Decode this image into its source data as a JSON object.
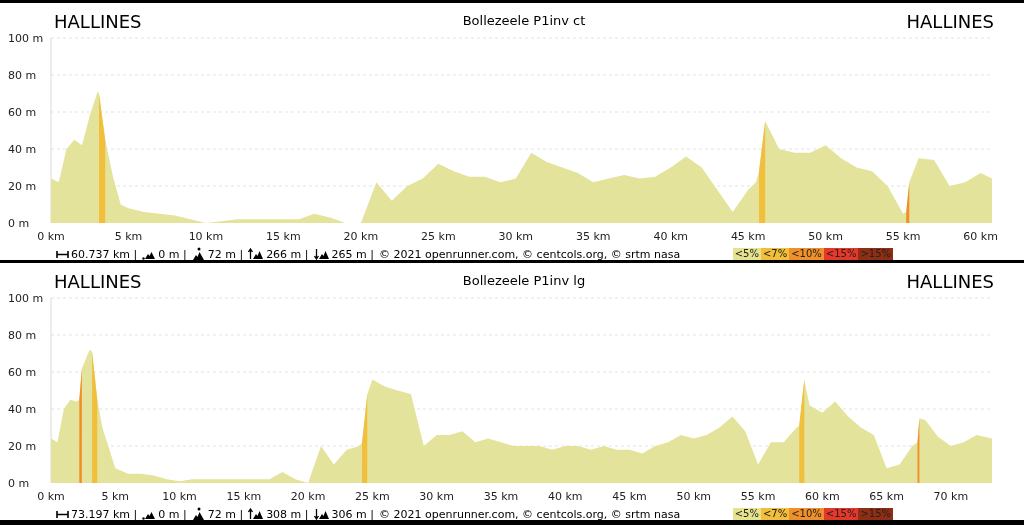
{
  "panels": [
    {
      "start": "HALLINES",
      "title": "Bollezeele P1inv ct",
      "finish": "HALLINES",
      "chart_data": {
        "type": "area",
        "xlim": [
          0,
          60.737
        ],
        "ylim": [
          0,
          100
        ],
        "xticks": [
          {
            "value": 0,
            "label": "0 km"
          },
          {
            "value": 5,
            "label": "5 km"
          },
          {
            "value": 10,
            "label": "10 km"
          },
          {
            "value": 15,
            "label": "15 km"
          },
          {
            "value": 20,
            "label": "20 km"
          },
          {
            "value": 25,
            "label": "25 km"
          },
          {
            "value": 30,
            "label": "30 km"
          },
          {
            "value": 35,
            "label": "35 km"
          },
          {
            "value": 40,
            "label": "40 km"
          },
          {
            "value": 45,
            "label": "45 km"
          },
          {
            "value": 50,
            "label": "50 km"
          },
          {
            "value": 55,
            "label": "55 km"
          },
          {
            "value": 60,
            "label": "60 km"
          }
        ],
        "yticks": [
          {
            "value": 0,
            "label": "0 m"
          },
          {
            "value": 20,
            "label": "20 m"
          },
          {
            "value": 40,
            "label": "40 m"
          },
          {
            "value": 60,
            "label": "60 m"
          },
          {
            "value": 80,
            "label": "80 m"
          },
          {
            "value": 100,
            "label": "100 m"
          }
        ],
        "x": [
          0,
          0.5,
          1,
          1.5,
          2,
          2.5,
          3,
          3.1,
          3.5,
          4,
          4.5,
          5,
          6,
          7,
          8,
          9,
          10,
          11,
          12,
          13,
          14,
          15,
          16,
          17,
          18,
          19,
          20,
          21,
          22,
          23,
          24,
          25,
          26,
          27,
          28,
          29,
          30,
          31,
          32,
          33,
          34,
          35,
          36,
          37,
          38,
          39,
          40,
          41,
          42,
          43,
          44,
          45,
          45.5,
          45.7,
          46.1,
          47,
          48,
          49,
          50,
          51,
          52,
          53,
          54,
          55,
          55.2,
          55.4,
          56,
          57,
          58,
          59,
          60,
          60.737
        ],
        "series": [
          {
            "color": "#e4e39b",
            "values": [
              24,
              22,
              40,
              45,
              42,
              58,
              71,
              70,
              45,
              25,
              10,
              8,
              6,
              5,
              4,
              2,
              0,
              1,
              2,
              2,
              2,
              2,
              2,
              5,
              3,
              0,
              0,
              22,
              12,
              20,
              24,
              32,
              28,
              25,
              25,
              22,
              24,
              38,
              33,
              30,
              27,
              22,
              24,
              26,
              24,
              25,
              30,
              36,
              30,
              18,
              6,
              18,
              22,
              28,
              55,
              40,
              38,
              38,
              42,
              35,
              30,
              28,
              20,
              5,
              6,
              22,
              35,
              34,
              20,
              22,
              27,
              24
            ]
          },
          {
            "color": "#f2bf3c",
            "values": [
              null,
              null,
              null,
              null,
              null,
              null,
              null,
              70,
              45,
              null,
              null,
              null,
              null,
              null,
              null,
              null,
              null,
              null,
              null,
              null,
              null,
              null,
              null,
              null,
              null,
              null,
              null,
              null,
              null,
              null,
              null,
              null,
              null,
              null,
              null,
              null,
              null,
              null,
              null,
              null,
              null,
              null,
              null,
              null,
              null,
              null,
              null,
              null,
              null,
              null,
              null,
              null,
              null,
              28,
              55,
              null,
              null,
              null,
              null,
              null,
              null,
              null,
              null,
              null,
              null,
              null,
              null,
              null,
              null,
              null,
              null,
              null
            ]
          },
          {
            "color": "#f0902a",
            "values": [
              null,
              null,
              null,
              null,
              null,
              null,
              null,
              null,
              null,
              null,
              null,
              null,
              null,
              null,
              null,
              null,
              null,
              null,
              null,
              null,
              null,
              null,
              null,
              null,
              null,
              null,
              null,
              null,
              null,
              null,
              null,
              null,
              null,
              null,
              null,
              null,
              null,
              null,
              null,
              null,
              null,
              null,
              null,
              null,
              null,
              null,
              null,
              null,
              null,
              null,
              null,
              null,
              null,
              null,
              null,
              null,
              null,
              null,
              null,
              null,
              null,
              null,
              null,
              null,
              6,
              22,
              null,
              null,
              null,
              null,
              null,
              null
            ]
          }
        ],
        "grid": true
      },
      "stats": [
        {
          "kind": "distance",
          "text": "60.737 km |"
        },
        {
          "kind": "min",
          "text": "0 m |"
        },
        {
          "kind": "max",
          "text": "72 m |"
        },
        {
          "kind": "ascent",
          "text": "266 m |"
        },
        {
          "kind": "descent",
          "text": "265 m |"
        }
      ],
      "credits": "© 2021 openrunner.com, © centcols.org, © srtm nasa",
      "legend": [
        {
          "label": "<5%",
          "color": "#e6e38f"
        },
        {
          "label": "<7%",
          "color": "#f2bf3c"
        },
        {
          "label": "<10%",
          "color": "#f0902a"
        },
        {
          "label": "<15%",
          "color": "#e5372a"
        },
        {
          "label": ">15%",
          "color": "#8e2e14"
        }
      ]
    },
    {
      "start": "HALLINES",
      "title": "Bollezeele P1inv lg",
      "finish": "HALLINES",
      "chart_data": {
        "type": "area",
        "xlim": [
          0,
          73.197
        ],
        "ylim": [
          0,
          100
        ],
        "xticks": [
          {
            "value": 0,
            "label": "0 km"
          },
          {
            "value": 5,
            "label": "5 km"
          },
          {
            "value": 10,
            "label": "10 km"
          },
          {
            "value": 15,
            "label": "15 km"
          },
          {
            "value": 20,
            "label": "20 km"
          },
          {
            "value": 25,
            "label": "25 km"
          },
          {
            "value": 30,
            "label": "30 km"
          },
          {
            "value": 35,
            "label": "35 km"
          },
          {
            "value": 40,
            "label": "40 km"
          },
          {
            "value": 45,
            "label": "45 km"
          },
          {
            "value": 50,
            "label": "50 km"
          },
          {
            "value": 55,
            "label": "55 km"
          },
          {
            "value": 60,
            "label": "60 km"
          },
          {
            "value": 65,
            "label": "65 km"
          },
          {
            "value": 70,
            "label": "70 km"
          }
        ],
        "yticks": [
          {
            "value": 0,
            "label": "0 m"
          },
          {
            "value": 20,
            "label": "20 m"
          },
          {
            "value": 40,
            "label": "40 m"
          },
          {
            "value": 60,
            "label": "60 m"
          },
          {
            "value": 80,
            "label": "80 m"
          },
          {
            "value": 100,
            "label": "100 m"
          }
        ],
        "x": [
          0,
          0.5,
          1,
          1.5,
          2,
          2.2,
          2.4,
          3,
          3.2,
          3.6,
          4,
          5,
          6,
          7,
          8,
          9,
          10,
          11,
          12,
          13,
          14,
          15,
          16,
          17,
          18,
          19,
          20,
          21,
          22,
          23,
          24,
          24.2,
          24.6,
          25,
          26,
          27,
          28,
          29,
          30,
          31,
          32,
          33,
          34,
          35,
          36,
          37,
          38,
          39,
          40,
          41,
          42,
          43,
          44,
          45,
          46,
          47,
          48,
          49,
          50,
          51,
          52,
          53,
          54,
          55,
          56,
          57,
          58,
          58.2,
          58.6,
          59,
          60,
          61,
          62,
          63,
          64,
          65,
          66,
          67,
          67.4,
          67.55,
          68,
          69,
          70,
          71,
          72,
          73.197
        ],
        "series": [
          {
            "color": "#e4e39b",
            "values": [
              24,
              22,
              40,
              45,
              44,
              45,
              62,
              72,
              71,
              45,
              30,
              8,
              5,
              5,
              4,
              2,
              1,
              2,
              2,
              2,
              2,
              2,
              2,
              2,
              6,
              2,
              0,
              20,
              10,
              18,
              20,
              22,
              48,
              56,
              52,
              50,
              48,
              20,
              26,
              26,
              28,
              22,
              24,
              22,
              20,
              20,
              20,
              18,
              20,
              20,
              18,
              20,
              18,
              18,
              16,
              20,
              22,
              26,
              24,
              26,
              30,
              36,
              28,
              10,
              22,
              22,
              30,
              31,
              56,
              42,
              38,
              44,
              36,
              30,
              26,
              8,
              10,
              20,
              22,
              35,
              34,
              25,
              20,
              22,
              26,
              24
            ]
          },
          {
            "color": "#f2bf3c",
            "values": [
              null,
              null,
              null,
              null,
              null,
              null,
              null,
              null,
              71,
              45,
              null,
              null,
              null,
              null,
              null,
              null,
              null,
              null,
              null,
              null,
              null,
              null,
              null,
              null,
              null,
              null,
              null,
              null,
              null,
              null,
              null,
              22,
              48,
              null,
              null,
              null,
              null,
              null,
              null,
              null,
              null,
              null,
              null,
              null,
              null,
              null,
              null,
              null,
              null,
              null,
              null,
              null,
              null,
              null,
              null,
              null,
              null,
              null,
              null,
              null,
              null,
              null,
              null,
              null,
              null,
              null,
              null,
              31,
              56,
              null,
              null,
              null,
              null,
              null,
              null,
              null,
              null,
              null,
              null,
              null,
              null,
              null,
              null,
              null,
              null,
              null
            ]
          },
          {
            "color": "#f0902a",
            "values": [
              null,
              null,
              null,
              null,
              null,
              45,
              62,
              null,
              null,
              null,
              null,
              null,
              null,
              null,
              null,
              null,
              null,
              null,
              null,
              null,
              null,
              null,
              null,
              null,
              null,
              null,
              null,
              null,
              null,
              null,
              null,
              null,
              null,
              null,
              null,
              null,
              null,
              null,
              null,
              null,
              null,
              null,
              null,
              null,
              null,
              null,
              null,
              null,
              null,
              null,
              null,
              null,
              null,
              null,
              null,
              null,
              null,
              null,
              null,
              null,
              null,
              null,
              null,
              null,
              null,
              null,
              null,
              null,
              null,
              null,
              null,
              null,
              null,
              null,
              null,
              null,
              null,
              null,
              22,
              35,
              null,
              null,
              null,
              null,
              null,
              null
            ]
          }
        ],
        "grid": true
      },
      "stats": [
        {
          "kind": "distance",
          "text": "73.197 km |"
        },
        {
          "kind": "min",
          "text": "0 m |"
        },
        {
          "kind": "max",
          "text": "72 m |"
        },
        {
          "kind": "ascent",
          "text": "308 m |"
        },
        {
          "kind": "descent",
          "text": "306 m |"
        }
      ],
      "credits": "© 2021 openrunner.com, © centcols.org, © srtm nasa",
      "legend": [
        {
          "label": "<5%",
          "color": "#e6e38f"
        },
        {
          "label": "<7%",
          "color": "#f2bf3c"
        },
        {
          "label": "<10%",
          "color": "#f0902a"
        },
        {
          "label": "<15%",
          "color": "#e5372a"
        },
        {
          "label": ">15%",
          "color": "#8e2e14"
        }
      ]
    }
  ]
}
